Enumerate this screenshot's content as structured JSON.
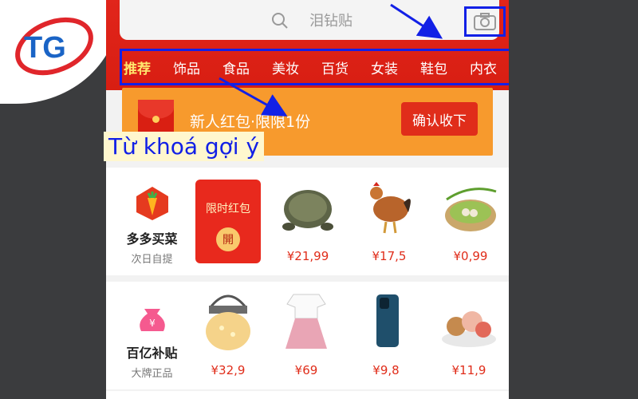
{
  "logo": {
    "text": "TG"
  },
  "search": {
    "placeholder": "泪钻贴"
  },
  "tabs": [
    "推荐",
    "饰品",
    "食品",
    "美妆",
    "百货",
    "女装",
    "鞋包",
    "内衣"
  ],
  "banner": {
    "text": "新人红包·限限1份",
    "button": "确认收下"
  },
  "annotation": {
    "label": "Từ khoá gợi ý"
  },
  "rows": [
    {
      "category": {
        "title": "多多买菜",
        "subtitle": "次日自提",
        "icon": "carrot-icon"
      },
      "redpack": {
        "title": "限时红包",
        "button": "開"
      },
      "items": [
        {
          "name": "turtle",
          "price": "¥21,99"
        },
        {
          "name": "rooster",
          "price": "¥17,5"
        },
        {
          "name": "scallions-eggs",
          "price": "¥0,99"
        }
      ]
    },
    {
      "category": {
        "title": "百亿补贴",
        "subtitle": "大牌正品",
        "icon": "money-bag-icon"
      },
      "items": [
        {
          "name": "lantern",
          "price": "¥32,9"
        },
        {
          "name": "dress",
          "price": "¥69"
        },
        {
          "name": "phone",
          "price": "¥9,8"
        },
        {
          "name": "dessert-plate",
          "price": "¥11,9"
        }
      ]
    }
  ],
  "colors": {
    "accent": "#e1251b",
    "highlight": "#1220e6",
    "banner": "#f79a2d"
  }
}
